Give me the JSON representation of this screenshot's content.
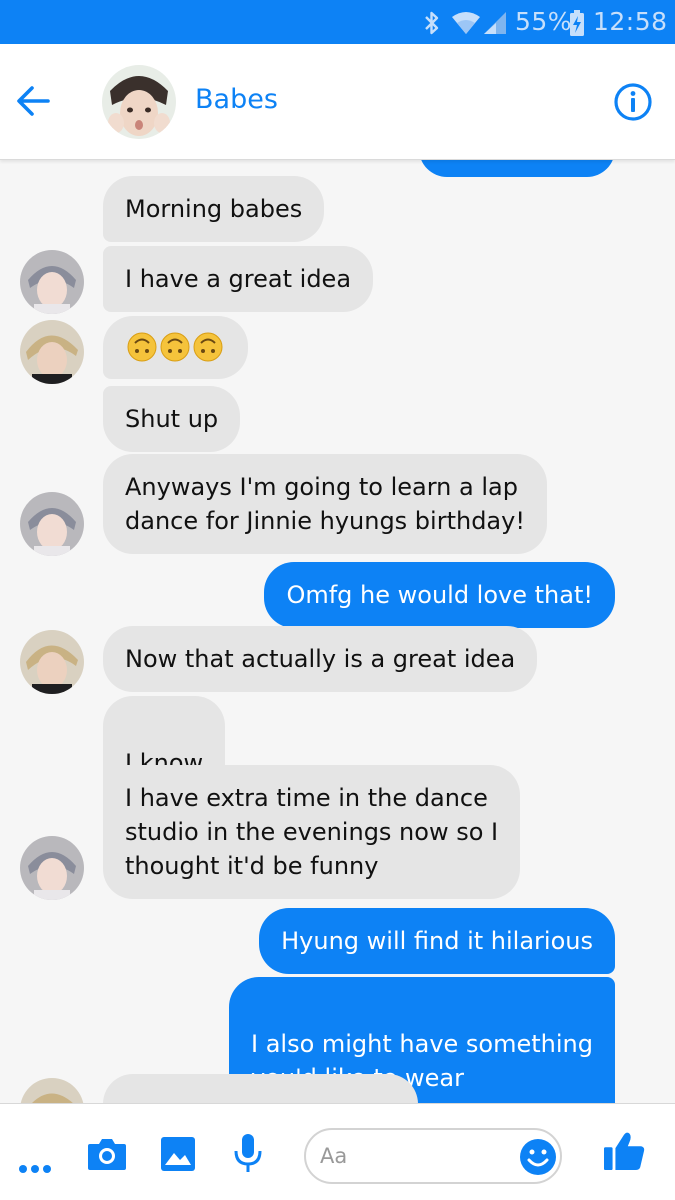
{
  "status_bar": {
    "battery_percent": "55%",
    "time": "12:58",
    "icons": [
      "bluetooth-icon",
      "wifi-icon",
      "signal-icon",
      "battery-charging-icon"
    ]
  },
  "header": {
    "contact_name": "Babes",
    "icons": [
      "back-arrow-icon",
      "info-icon"
    ]
  },
  "messages": [
    {
      "direction": "in",
      "text": "Morning babes"
    },
    {
      "direction": "in",
      "text": "I have a great idea"
    },
    {
      "direction": "in",
      "text": "🙃🙃🙃"
    },
    {
      "direction": "in",
      "text": "Shut up"
    },
    {
      "direction": "in",
      "text": "Anyways I'm going to learn a lap\ndance for Jinnie hyungs birthday!"
    },
    {
      "direction": "out",
      "text": "Omfg he would love that!"
    },
    {
      "direction": "in",
      "text": "Now that actually is a great idea"
    },
    {
      "direction": "in",
      "text": "I know"
    },
    {
      "direction": "in",
      "text": "I have extra time in the dance\nstudio in the evenings now so I\nthought it'd be funny"
    },
    {
      "direction": "out",
      "text": "Hyung will find it hilarious"
    },
    {
      "direction": "out",
      "text": "I also might have something\nyou'd like to wear"
    }
  ],
  "composer": {
    "placeholder": "Aa",
    "icons": [
      "more-icon",
      "camera-icon",
      "image-icon",
      "microphone-icon",
      "emoji-icon",
      "thumbs-up-icon"
    ]
  },
  "colors": {
    "brand_blue": "#0d82f5",
    "incoming_bubble": "#e5e5e5",
    "background": "#f6f6f6"
  }
}
